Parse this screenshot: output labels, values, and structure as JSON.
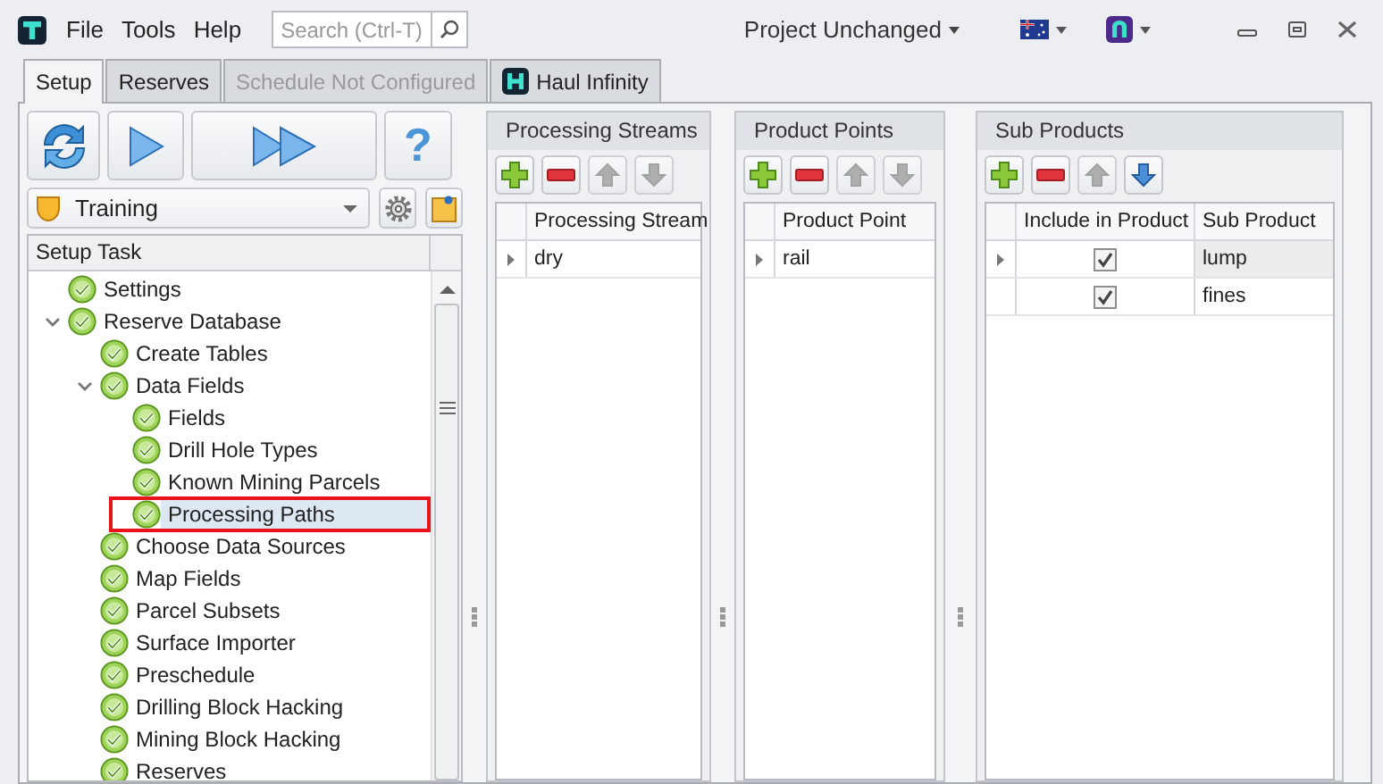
{
  "menu": [
    "File",
    "Tools",
    "Help"
  ],
  "search": {
    "placeholder": "Search (Ctrl-T)"
  },
  "project": {
    "label": "Project Unchanged"
  },
  "tabs": [
    {
      "label": "Setup",
      "selected": true,
      "disabled": false
    },
    {
      "label": "Reserves",
      "selected": false,
      "disabled": false
    },
    {
      "label": "Schedule Not Configured",
      "selected": false,
      "disabled": true
    },
    {
      "label": "Haul Infinity",
      "selected": false,
      "disabled": false,
      "kind": "app"
    }
  ],
  "help_button": {
    "label": "?"
  },
  "profile": {
    "value": "Training"
  },
  "tree": {
    "header": "Setup Task",
    "items": [
      {
        "label": "Settings",
        "selected": false
      },
      {
        "label": "Reserve Database",
        "selected": false,
        "expanded": true,
        "children": [
          {
            "label": "Create Tables",
            "selected": false
          },
          {
            "label": "Data Fields",
            "selected": false,
            "expanded": true,
            "children": [
              {
                "label": "Fields",
                "selected": false
              },
              {
                "label": "Drill Hole Types",
                "selected": false
              },
              {
                "label": "Known Mining Parcels",
                "selected": false
              },
              {
                "label": "Processing Paths",
                "selected": true,
                "highlighted": true
              }
            ]
          },
          {
            "label": "Choose Data Sources",
            "selected": false
          },
          {
            "label": "Map Fields",
            "selected": false
          },
          {
            "label": "Parcel Subsets",
            "selected": false
          },
          {
            "label": "Surface Importer",
            "selected": false
          },
          {
            "label": "Preschedule",
            "selected": false
          },
          {
            "label": "Drilling Block Hacking",
            "selected": false
          },
          {
            "label": "Mining Block Hacking",
            "selected": false
          },
          {
            "label": "Reserves",
            "selected": false
          }
        ]
      }
    ]
  },
  "panels": [
    {
      "title": "Processing Streams",
      "buttons": [
        {
          "kind": "add",
          "disabled": false
        },
        {
          "kind": "remove",
          "disabled": false
        },
        {
          "kind": "up",
          "disabled": true
        },
        {
          "kind": "down",
          "disabled": true
        }
      ],
      "columns": [
        {
          "label": "Processing Stream",
          "kind": "text"
        }
      ],
      "rows": [
        {
          "current": true,
          "values": [
            "dry"
          ]
        }
      ]
    },
    {
      "title": "Product Points",
      "buttons": [
        {
          "kind": "add",
          "disabled": false
        },
        {
          "kind": "remove",
          "disabled": false
        },
        {
          "kind": "up",
          "disabled": true
        },
        {
          "kind": "down",
          "disabled": true
        }
      ],
      "columns": [
        {
          "label": "Product Point",
          "kind": "text"
        }
      ],
      "rows": [
        {
          "current": true,
          "values": [
            "rail"
          ]
        }
      ]
    },
    {
      "title": "Sub Products",
      "buttons": [
        {
          "kind": "add",
          "disabled": false
        },
        {
          "kind": "remove",
          "disabled": false
        },
        {
          "kind": "up",
          "disabled": true
        },
        {
          "kind": "down",
          "disabled": false
        }
      ],
      "columns": [
        {
          "label": "Include in Product",
          "kind": "check"
        },
        {
          "label": "Sub Product",
          "kind": "text"
        }
      ],
      "rows": [
        {
          "current": true,
          "values": [
            true,
            "lump"
          ]
        },
        {
          "current": false,
          "values": [
            true,
            "fines"
          ]
        }
      ]
    }
  ]
}
